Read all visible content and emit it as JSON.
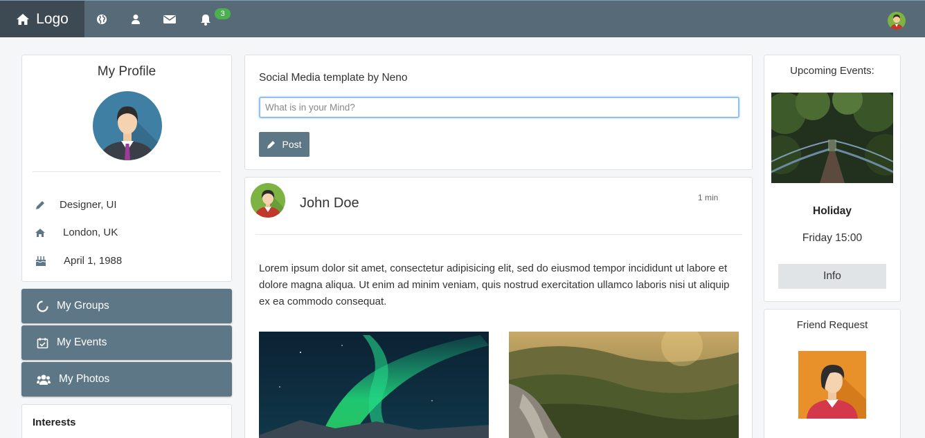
{
  "nav": {
    "logo_label": "Logo",
    "notifications_count": "3",
    "icons": [
      "home-icon",
      "globe-icon",
      "user-icon",
      "envelope-icon",
      "bell-icon"
    ]
  },
  "profile": {
    "title": "My Profile",
    "occupation": "Designer, UI",
    "location": "London, UK",
    "birthday": "April 1, 1988"
  },
  "menu": {
    "groups": "My Groups",
    "events": "My Events",
    "photos": "My Photos"
  },
  "interests": {
    "title": "Interests"
  },
  "compose": {
    "title": "Social Media template by Neno",
    "placeholder": "What is in your Mind?",
    "post_label": "Post"
  },
  "post": {
    "author": "John Doe",
    "time": "1 min",
    "text": "Lorem ipsum dolor sit amet, consectetur adipisicing elit, sed do eiusmod tempor incididunt ut labore et dolore magna aliqua. Ut enim ad minim veniam, quis nostrud exercitation ullamco laboris nisi ut aliquip ex ea commodo consequat."
  },
  "events": {
    "title": "Upcoming Events:",
    "name": "Holiday",
    "time": "Friday 15:00",
    "info_label": "Info"
  },
  "friend": {
    "title": "Friend Request"
  },
  "colors": {
    "navbar": "#566a78",
    "nav_logo_bg": "#3d4a53",
    "accent": "#5e7786",
    "badge": "#4caf50"
  }
}
